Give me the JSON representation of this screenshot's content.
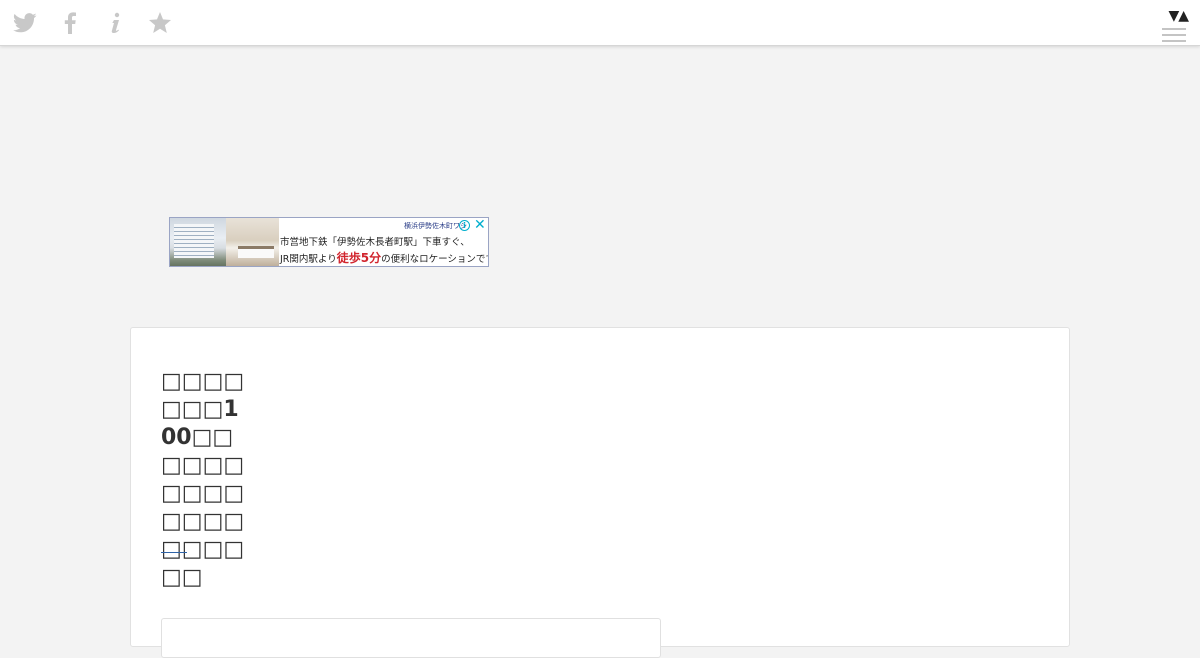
{
  "topbar": {
    "social_icons": [
      "twitter-icon",
      "facebook-icon",
      "info-icon",
      "star-icon"
    ],
    "icon_color": "#c8c8c8",
    "sort_arrows": "▼▲",
    "menu_icon": "hamburger-icon"
  },
  "ad": {
    "brand": "横浜伊勢佐木町ワシ",
    "line1": "市営地下鉄「伊勢佐木長者町駅」下車すぐ、",
    "line2_prefix": "JR関内駅より",
    "line2_highlight": "徒歩5分",
    "line2_suffix": "の便利なロケーションです。",
    "info_symbol": "i",
    "close_symbol": "✕",
    "accent_color": "#00aecd"
  },
  "article": {
    "title": "□□□□□□□100□□□□□□□□□□□□□□□□□□□□",
    "rule_color": "#2f63a7"
  }
}
